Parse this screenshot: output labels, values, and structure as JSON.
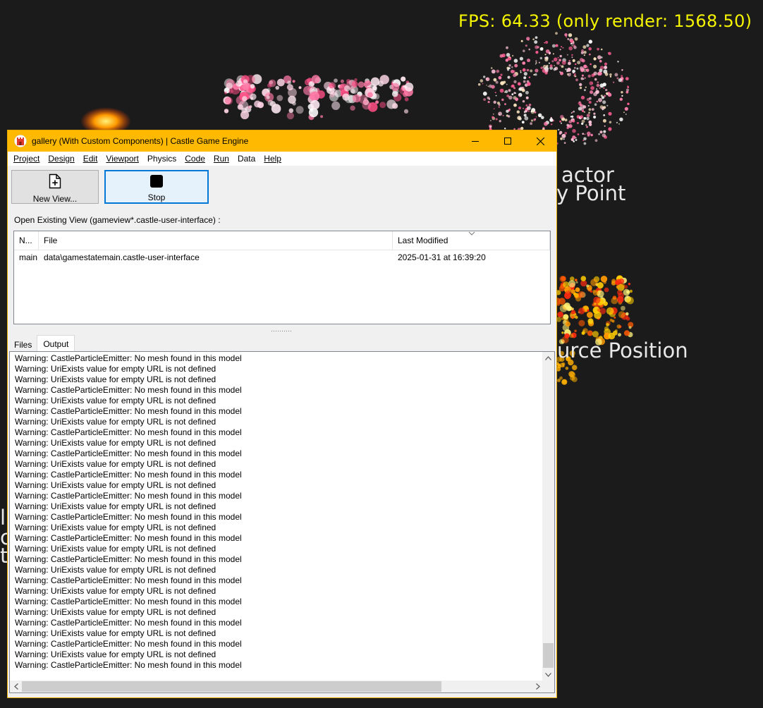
{
  "game": {
    "fps_text": "FPS: 64.33 (only render: 1568.50)",
    "labels": {
      "attractor_line1": "actor",
      "attractor_line2": "y Point",
      "source_position": "urce Position",
      "left_fragment_1": "l",
      "left_fragment_2": "c",
      "left_fragment_3": "t"
    },
    "colors": {
      "fps": "#f5f500",
      "background": "#1b1b1b",
      "label": "#e8e8e8"
    }
  },
  "window": {
    "title": "gallery (With Custom Components) | Castle Game Engine",
    "app_icon": "castle-game-engine-icon",
    "controls": {
      "minimize": "minimize-icon",
      "maximize": "maximize-icon",
      "close": "close-icon"
    },
    "accent": "#ffba00"
  },
  "menu": [
    {
      "label": "Project"
    },
    {
      "label": "Design"
    },
    {
      "label": "Edit"
    },
    {
      "label": "Viewport"
    },
    {
      "label": "Physics"
    },
    {
      "label": "Code"
    },
    {
      "label": "Run"
    },
    {
      "label": "Data"
    },
    {
      "label": "Help"
    }
  ],
  "toolbar": {
    "new_view_label": "New View...",
    "new_view_icon": "new-file-icon",
    "stop_label": "Stop",
    "stop_icon": "stop-icon"
  },
  "open_existing_label": "Open Existing View (gameview*.castle-user-interface) :",
  "views_table": {
    "columns": [
      "N...",
      "File",
      "Last Modified"
    ],
    "rows": [
      [
        "main",
        "data\\gamestatemain.castle-user-interface",
        "2025-01-31 at 16:39:20"
      ]
    ]
  },
  "tabs": {
    "files": "Files",
    "output": "Output",
    "active": "Output"
  },
  "output_lines": [
    "Warning: CastleParticleEmitter: No mesh found in this model",
    "Warning: UriExists value for empty URL is not defined",
    "Warning: UriExists value for empty URL is not defined",
    "Warning: CastleParticleEmitter: No mesh found in this model",
    "Warning: UriExists value for empty URL is not defined",
    "Warning: CastleParticleEmitter: No mesh found in this model",
    "Warning: UriExists value for empty URL is not defined",
    "Warning: CastleParticleEmitter: No mesh found in this model",
    "Warning: UriExists value for empty URL is not defined",
    "Warning: CastleParticleEmitter: No mesh found in this model",
    "Warning: UriExists value for empty URL is not defined",
    "Warning: CastleParticleEmitter: No mesh found in this model",
    "Warning: UriExists value for empty URL is not defined",
    "Warning: CastleParticleEmitter: No mesh found in this model",
    "Warning: UriExists value for empty URL is not defined",
    "Warning: CastleParticleEmitter: No mesh found in this model",
    "Warning: UriExists value for empty URL is not defined",
    "Warning: CastleParticleEmitter: No mesh found in this model",
    "Warning: UriExists value for empty URL is not defined",
    "Warning: CastleParticleEmitter: No mesh found in this model",
    "Warning: UriExists value for empty URL is not defined",
    "Warning: CastleParticleEmitter: No mesh found in this model",
    "Warning: UriExists value for empty URL is not defined",
    "Warning: CastleParticleEmitter: No mesh found in this model",
    "Warning: UriExists value for empty URL is not defined",
    "Warning: CastleParticleEmitter: No mesh found in this model",
    "Warning: UriExists value for empty URL is not defined",
    "Warning: CastleParticleEmitter: No mesh found in this model",
    "Warning: UriExists value for empty URL is not defined",
    "Warning: CastleParticleEmitter: No mesh found in this model"
  ]
}
